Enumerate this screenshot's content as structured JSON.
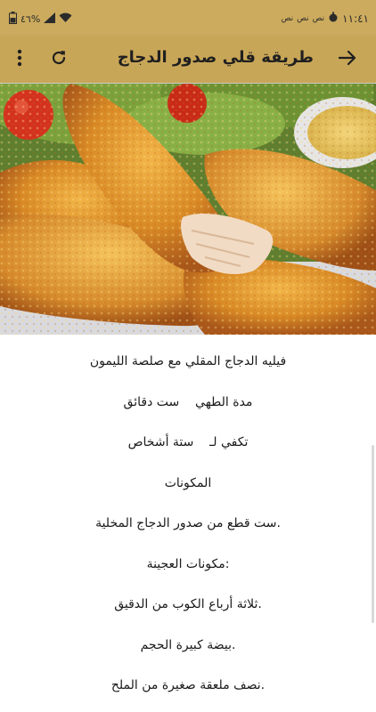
{
  "status_bar": {
    "time": "١١:٤١",
    "notif_1": "نص",
    "notif_2": "نص",
    "notif_3": "نص",
    "f_label": "F",
    "battery": "٤٦%"
  },
  "app_bar": {
    "title": "طريقة قلي صدور الدجاج",
    "back_icon": "arrow-right-icon",
    "refresh_icon": "refresh-icon",
    "menu_icon": "more-vertical-icon"
  },
  "hero_image": {
    "subject": "fried-chicken-tenders-with-salad-and-dip"
  },
  "recipe_lines": [
    "فيليه الدجاج المقلي مع صلصة الليمون",
    "مدة الطهي    ست دقائق",
    "تكفي لـ    ستة أشخاص",
    "المكونات",
    ".ست قطع من صدور الدجاج المخلية",
    ":مكونات العجينة",
    ".ثلاثة أرباع الكوب من الدقيق",
    ".بيضة كبيرة الحجم",
    ".نصف ملعقة صغيرة من الملح"
  ],
  "colors": {
    "app_bar": "#c8a657",
    "status_bar": "#ccab5e",
    "text": "#1a1a1a"
  }
}
